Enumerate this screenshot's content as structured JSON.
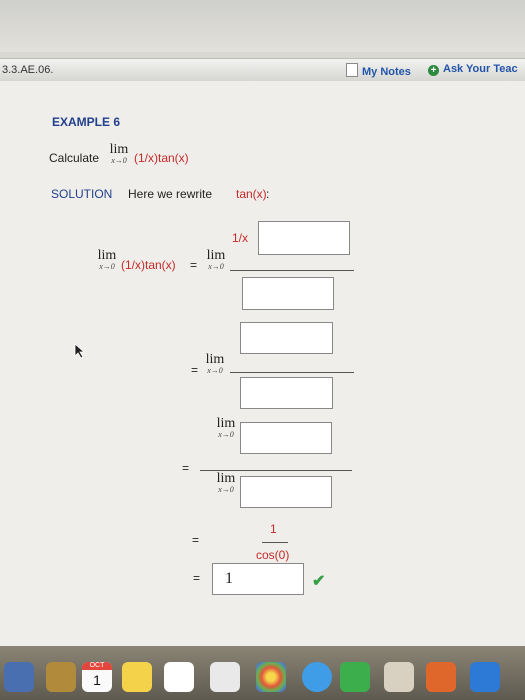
{
  "header": {
    "problem_id": "3.3.AE.06.",
    "notes_label": "My Notes",
    "ask_label": "Ask Your Teac"
  },
  "example": {
    "title": "EXAMPLE 6",
    "prompt": "Calculate",
    "lim_word": "lim",
    "lim_sub": "x→0",
    "expression": "(1/x)tan(x)",
    "solution_label": "SOLUTION",
    "solution_text": "Here we rewrite",
    "solution_func": "tan(x)",
    "colon": ":"
  },
  "steps": {
    "numerator_label": "1/x",
    "equals": "=",
    "final_num": "1",
    "final_den": "cos(0)",
    "answer_value": "1",
    "check": "✔"
  },
  "dock": {
    "calendar_month": "OCT",
    "calendar_day": "1"
  }
}
